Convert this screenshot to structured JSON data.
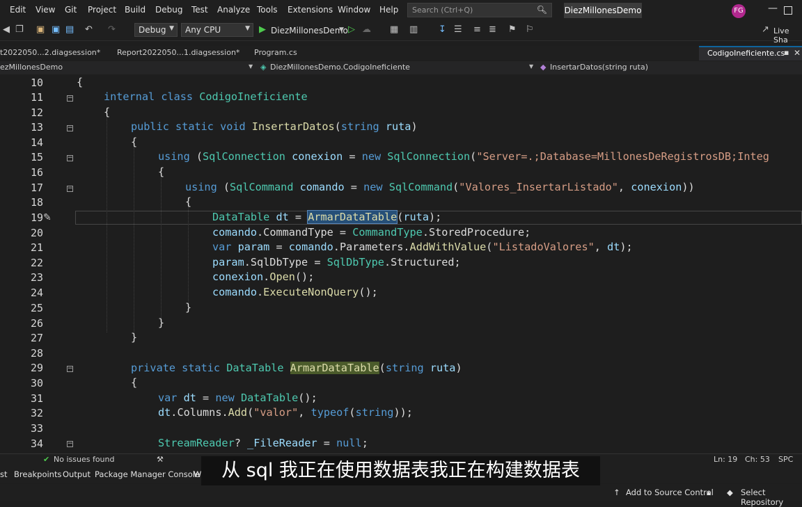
{
  "menu": [
    "Edit",
    "View",
    "Git",
    "Project",
    "Build",
    "Debug",
    "Test",
    "Analyze",
    "Tools",
    "Extensions",
    "Window",
    "Help"
  ],
  "search_placeholder": "Search (Ctrl+Q)",
  "solution_name": "DiezMillonesDemo",
  "avatar_initials": "FG",
  "toolbar": {
    "config": "Debug",
    "platform": "Any CPU",
    "run_target": "DiezMillonesDemo",
    "live_share": "Live Sha"
  },
  "tabs": [
    "t2022050...2.diagsession*",
    "Report2022050...1.diagsession*",
    "Program.cs",
    "CodigoIneficiente.cs"
  ],
  "navbar": {
    "project": "ezMillonesDemo",
    "type": "DiezMillonesDemo.CodigoIneficiente",
    "member": "InsertarDatos(string ruta)"
  },
  "line_numbers": [
    "10",
    "11",
    "12",
    "13",
    "14",
    "15",
    "16",
    "17",
    "18",
    "19",
    "20",
    "21",
    "22",
    "23",
    "24",
    "25",
    "26",
    "27",
    "28",
    "29",
    "30",
    "31",
    "32",
    "33",
    "34"
  ],
  "code_lines": [
    "{",
    "internal class CodigoIneficiente",
    "{",
    "public static void InsertarDatos(string ruta)",
    "{",
    "using (SqlConnection conexion = new SqlConnection(\"Server=.;Database=MillonesDeRegistrosDB;Integ",
    "{",
    "using (SqlCommand comando = new SqlCommand(\"Valores_InsertarListado\", conexion))",
    "{",
    "DataTable dt = ArmarDataTable(ruta);",
    "comando.CommandType = CommandType.StoredProcedure;",
    "var param = comando.Parameters.AddWithValue(\"ListadoValores\", dt);",
    "param.SqlDbType = SqlDbType.Structured;",
    "conexion.Open();",
    "comando.ExecuteNonQuery();",
    "}",
    "}",
    "}",
    "",
    "private static DataTable ArmarDataTable(string ruta)",
    "{",
    "var dt = new DataTable();",
    "dt.Columns.Add(\"valor\", typeof(string));",
    "",
    "StreamReader? _FileReader = null;"
  ],
  "status": {
    "issues": "No issues found",
    "ln": "Ln: 19",
    "ch": "Ch: 53",
    "mode": "SPC"
  },
  "bottom_tabs": [
    "st",
    "Breakpoints",
    "Output",
    "Package Manager Console",
    "W"
  ],
  "subtitle": "从 sql 我正在使用数据表我正在构建数据表",
  "footer": {
    "source_control": "Add to Source Control",
    "repository": "Select Repository"
  },
  "colors": {
    "keyword": "#569cd6",
    "type": "#4ec9b0",
    "method": "#dcdcaa",
    "string": "#d69d85",
    "identifier": "#9cdcfe",
    "selection": "#264f78"
  }
}
